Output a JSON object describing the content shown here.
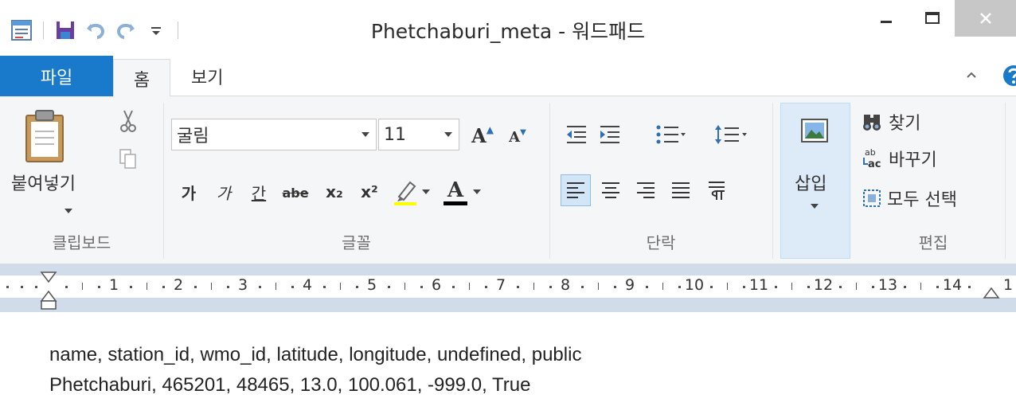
{
  "window": {
    "title": "Phetchaburi_meta - 워드패드"
  },
  "quick_access": {
    "icons": [
      "wordpad-app-icon",
      "save-icon",
      "undo-icon",
      "redo-icon",
      "customize-dropdown-icon"
    ]
  },
  "tabs": {
    "file": "파일",
    "home": "홈",
    "view": "보기"
  },
  "ribbon": {
    "clipboard": {
      "label": "클립보드",
      "paste": "붙여넣기"
    },
    "font": {
      "label": "글꼴",
      "family": "굴림",
      "size": "11",
      "grow_glyph": "A",
      "shrink_glyph": "A",
      "bold_glyph": "가",
      "italic_glyph": "가",
      "underline_glyph": "간",
      "strike_glyph": "abe",
      "sub_glyph": "x₂",
      "sup_glyph": "x²",
      "color_glyph": "A"
    },
    "paragraph": {
      "label": "단락"
    },
    "insert": {
      "label": "삽입"
    },
    "editing": {
      "label": "편집",
      "find": "찾기",
      "replace": "바꾸기",
      "select_all": "모두 선택"
    }
  },
  "ruler": {
    "numbers": [
      "1",
      "2",
      "3",
      "4",
      "5",
      "6",
      "7",
      "8",
      "9",
      "10",
      "11",
      "12",
      "13",
      "14"
    ],
    "tail": "1"
  },
  "document": {
    "lines": [
      "name, station_id, wmo_id, latitude, longitude, undefined, public",
      "Phetchaburi, 465201, 48465, 13.0, 100.061, -999.0, True"
    ]
  },
  "colors": {
    "file_tab": "#1979ca",
    "ribbon_bg": "#f5f6f7",
    "ruler_bg": "#d1dcea",
    "active_button": "#d2e6f8"
  }
}
